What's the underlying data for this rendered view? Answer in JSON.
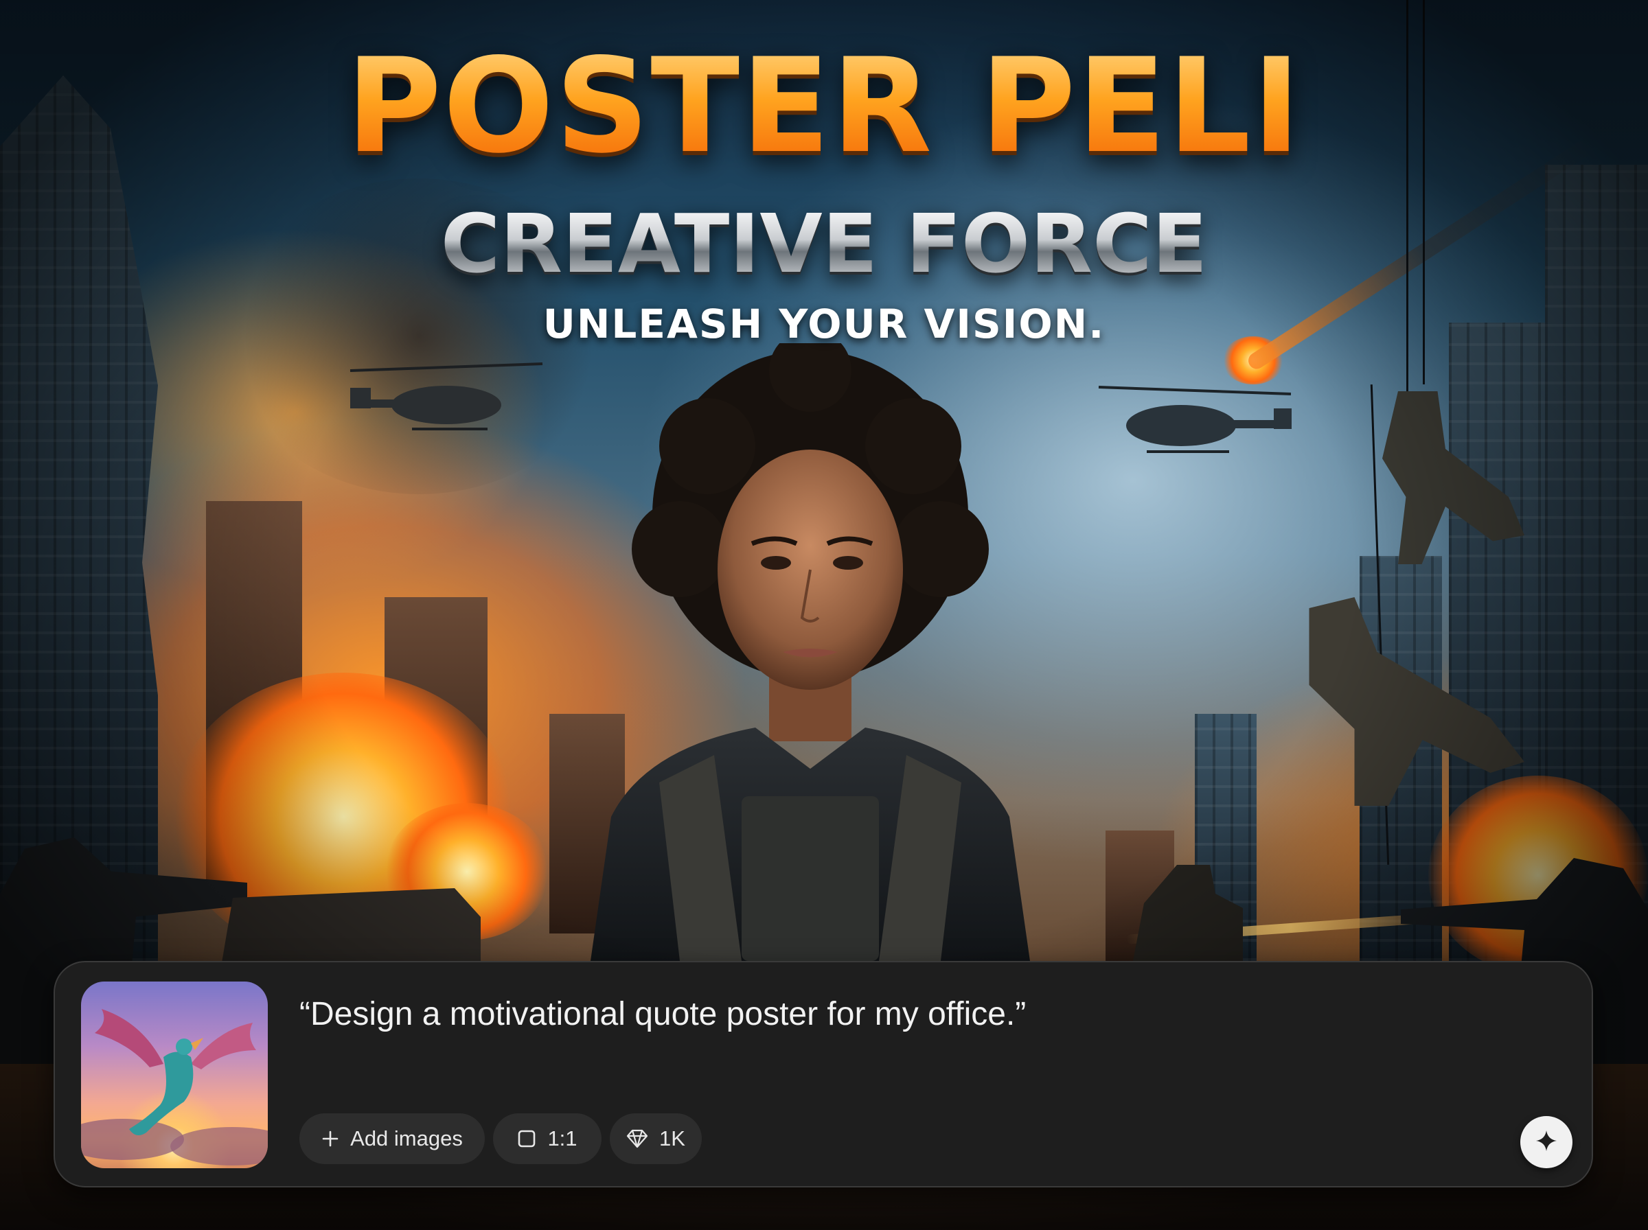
{
  "poster": {
    "title": "POSTER PELI",
    "subtitle": "CREATIVE FORCE",
    "tagline": "UNLEASH YOUR VISION."
  },
  "prompt_panel": {
    "prompt_text": "“Design a motivational quote poster for my office.”",
    "thumbnail_icon": "dragon-sunset-thumbnail",
    "add_images_label": "Add images",
    "aspect_ratio_label": "1:1",
    "resolution_label": "1K",
    "send_icon": "sparkle-icon"
  },
  "colors": {
    "title_orange": "#ff8e1a",
    "panel_bg": "#1e1e1e",
    "chip_bg": "#2d2d2d",
    "send_button_bg": "#f1f1f1"
  }
}
